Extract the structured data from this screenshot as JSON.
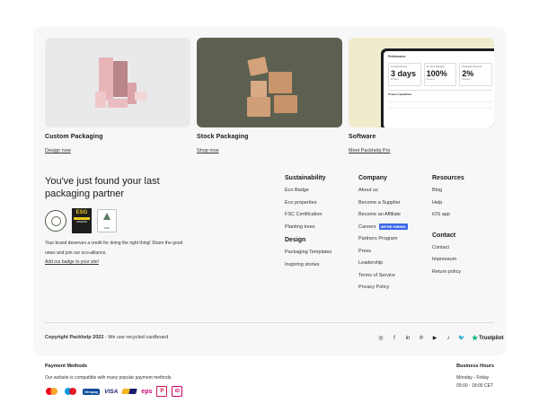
{
  "cards": [
    {
      "title": "Custom Packaging",
      "link": "Design now"
    },
    {
      "title": "Stock Packaging",
      "link": "Shop now"
    },
    {
      "title": "Software",
      "link": "Meet Packhelp Pro"
    }
  ],
  "software_screen": {
    "title": "Performance",
    "metrics": [
      {
        "label": "Turnaround time",
        "value": "3 days",
        "sub": "Excellent"
      },
      {
        "label": "On Time Shipping",
        "value": "100%",
        "sub": "Excellent"
      },
      {
        "label": "Production Success",
        "value": "2%",
        "sub": "Excellent"
      }
    ],
    "capabilities": "Product capabilities"
  },
  "headline": "You've just found your last packaging partner",
  "badges": {
    "esg": "ESG",
    "esg_sub": "ADVANCE",
    "fsc": "FSC"
  },
  "blurb": {
    "text": "Your brand deserves a credit for doing the right thing! Share the good news and join our eco-alliance.",
    "link": "Add our badge to your site!"
  },
  "columns": {
    "sustainability": {
      "heading": "Sustainability",
      "items": [
        "Eco Badge",
        "Eco properties",
        "FSC Certification",
        "Planting trees"
      ]
    },
    "design": {
      "heading": "Design",
      "items": [
        "Packaging Templates",
        "Inspiring stories"
      ]
    },
    "company": {
      "heading": "Company",
      "items": [
        "About us",
        "Become a Supplier",
        "Become an Affiliate",
        "Careers",
        "Partners Program",
        "Press",
        "Leadership",
        "Terms of Service",
        "Privacy Policy"
      ],
      "hiring_badge": "WE'RE HIRING"
    },
    "resources": {
      "heading": "Resources",
      "items": [
        "Blog",
        "Help",
        "iOS app"
      ]
    },
    "contact": {
      "heading": "Contact",
      "items": [
        "Contact",
        "Impressum",
        "Return policy"
      ]
    }
  },
  "copyright": {
    "text": "Copyright Packhelp 2022",
    "note": " · We use recycled cardboard"
  },
  "socials": {
    "instagram": "◎",
    "facebook": "f",
    "linkedin": "in",
    "pinterest": "℗",
    "youtube": "▶",
    "tiktok": "♪",
    "twitter": "🐦",
    "trustpilot": "Trustpilot"
  },
  "payments": {
    "heading": "Payment Methods",
    "text": "Our website is compatible with many popular payment methods.",
    "giropay": "Giropay",
    "visa": "VISA",
    "eps": "eps",
    "p24": "P",
    "ideal": "iD"
  },
  "business_hours": {
    "heading": "Business Hours",
    "days": "Monday - Friday",
    "time": "09:00 - 18:00 CET"
  },
  "colors": {
    "accent": "#3a66e8",
    "trustpilot_green": "#00b67a"
  }
}
